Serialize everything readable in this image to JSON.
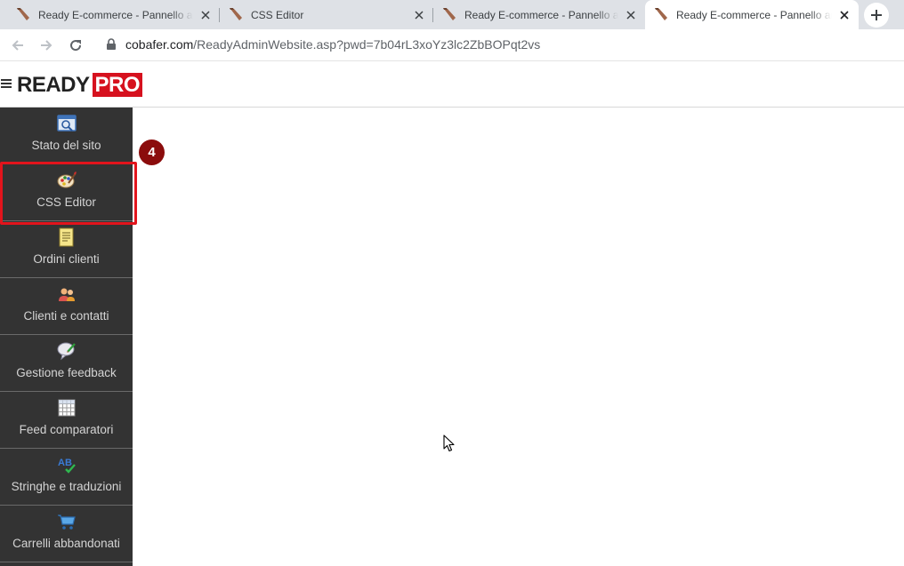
{
  "browser": {
    "tabs": [
      {
        "title": "Ready E-commerce - Pannello amministrazione",
        "active": false
      },
      {
        "title": "CSS Editor",
        "active": false
      },
      {
        "title": "Ready E-commerce - Pannello amministrazione",
        "active": false
      },
      {
        "title": "Ready E-commerce - Pannello amministrazione",
        "active": true
      }
    ],
    "address": {
      "host": "cobafer.com",
      "path": "/ReadyAdminWebsite.asp?pwd=7b04rL3xoYz3lc2ZbBOPqt2vs"
    }
  },
  "header": {
    "logo_ready": "READY",
    "logo_pro": "PRO"
  },
  "sidebar": {
    "items": [
      {
        "label": "Stato del sito",
        "icon": "site-status-icon"
      },
      {
        "label": "CSS Editor",
        "icon": "palette-icon"
      },
      {
        "label": "Ordini clienti",
        "icon": "notepad-icon"
      },
      {
        "label": "Clienti e contatti",
        "icon": "people-icon"
      },
      {
        "label": "Gestione feedback",
        "icon": "feedback-icon"
      },
      {
        "label": "Feed comparatori",
        "icon": "grid-icon"
      },
      {
        "label": "Stringhe e traduzioni",
        "icon": "translate-icon"
      },
      {
        "label": "Carrelli abbandonati",
        "icon": "cart-icon"
      }
    ]
  },
  "annotation": {
    "step": "4",
    "highlight_color": "#e2141c",
    "badge_color": "#8b0c0c"
  },
  "colors": {
    "sidebar_bg": "#333333",
    "brand_red": "#d6111e"
  }
}
